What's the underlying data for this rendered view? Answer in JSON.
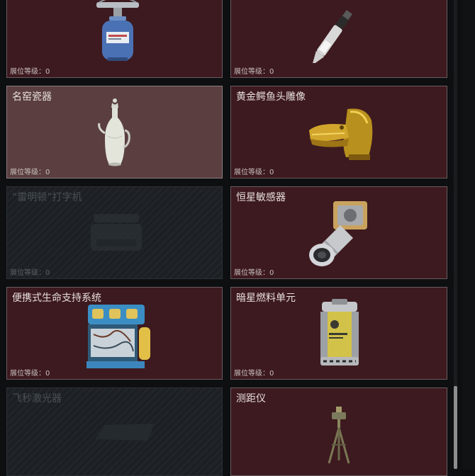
{
  "level_label": "展位等级：",
  "items": [
    {
      "title": "",
      "level": "0",
      "state": "normal",
      "icon": "gas-canister-icon"
    },
    {
      "title": "",
      "level": "0",
      "state": "normal",
      "icon": "knife-pen-icon"
    },
    {
      "title": "名窑瓷器",
      "level": "0",
      "state": "selected",
      "icon": "porcelain-vase-icon"
    },
    {
      "title": "黄金鳄鱼头雕像",
      "level": "0",
      "state": "normal",
      "icon": "golden-crocodile-head-icon"
    },
    {
      "title": "“雷明顿”打字机",
      "level": "0",
      "state": "locked",
      "icon": "typewriter-icon"
    },
    {
      "title": "恒星敏感器",
      "level": "0",
      "state": "normal",
      "icon": "star-sensor-icon"
    },
    {
      "title": "便携式生命支持系统",
      "level": "0",
      "state": "normal",
      "icon": "life-support-system-icon"
    },
    {
      "title": "暗星燃料单元",
      "level": "0",
      "state": "normal",
      "icon": "fuel-cell-icon"
    },
    {
      "title": "飞秒激光器",
      "level": "",
      "state": "locked",
      "icon": "femtosecond-laser-icon"
    },
    {
      "title": "测距仪",
      "level": "",
      "state": "normal",
      "icon": "rangefinder-tripod-icon"
    }
  ]
}
